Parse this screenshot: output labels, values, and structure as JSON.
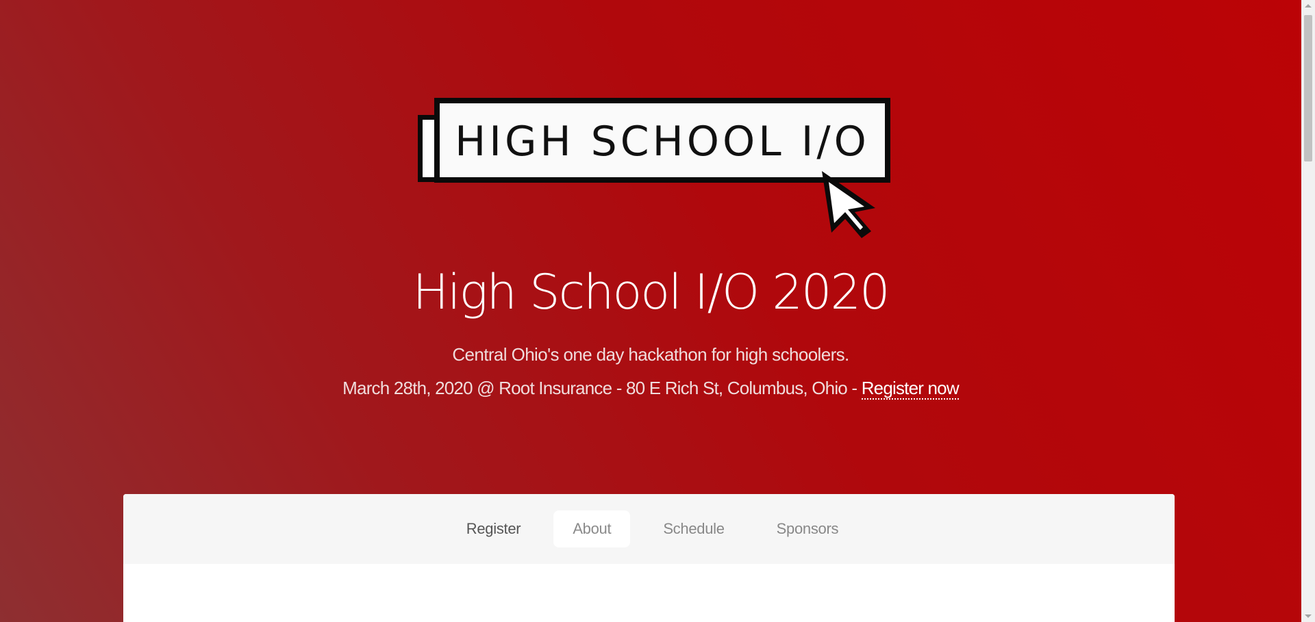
{
  "logo": {
    "text": "HIGH SCHOOL I/O",
    "icon": "pointer-cursor-icon"
  },
  "hero": {
    "title": "High School I/O 2020",
    "tagline": "Central Ohio's one day hackathon for high schoolers.",
    "details": "March 28th, 2020 @ Root Insurance - 80 E Rich St, Columbus, Ohio - ",
    "register_link": "Register now"
  },
  "nav": {
    "items": [
      {
        "label": "Register"
      },
      {
        "label": "About"
      },
      {
        "label": "Schedule"
      },
      {
        "label": "Sponsors"
      }
    ]
  },
  "colors": {
    "gradient_start": "#8e2f31",
    "gradient_end": "#bb0306",
    "card_nav_bg": "#f6f6f6"
  }
}
